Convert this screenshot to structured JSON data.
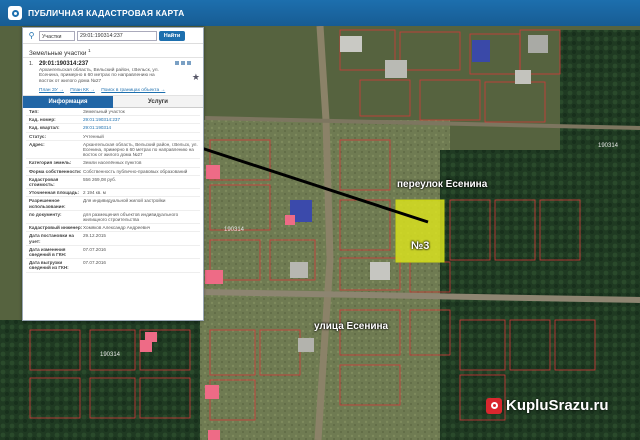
{
  "app": {
    "title": "ПУБЛИЧНАЯ КАДАСТРОВАЯ КАРТА"
  },
  "search": {
    "type": "Участки",
    "value": "29:01:190314:237",
    "button": "Найти"
  },
  "section": {
    "title": "Земельные участки",
    "count": "1"
  },
  "object": {
    "number": "1.",
    "cadastral": "29:01:190314:237",
    "address": "Архангельская область, Вельский район, г.Вельск, ул. Есенина, примерно в 60 метрах по направлению на восток от жилого дома №27",
    "links": [
      "План ЗУ →",
      "План КК →",
      "Поиск в границах объекта →"
    ]
  },
  "tabs": {
    "info": "Информация",
    "services": "Услуги"
  },
  "details": [
    {
      "k": "Тип:",
      "v": "Земельный участок"
    },
    {
      "k": "Кад. номер:",
      "v": "29:01:190314:237"
    },
    {
      "k": "Кад. квартал:",
      "v": "29:01:190314"
    },
    {
      "k": "Статус:",
      "v": "Учтенный"
    },
    {
      "k": "Адрес:",
      "v": "Архангельская область, Вельский район, г.Вельск, ул. Есенина, примерно в 60 метрах по направлению на восток от жилого дома №27"
    },
    {
      "k": "Категория земель:",
      "v": "Земли населённых пунктов"
    },
    {
      "k": "Форма собственности:",
      "v": "Собственность публично-правовых образований"
    },
    {
      "k": "Кадастровая стоимость:",
      "v": "556 269,08 руб."
    },
    {
      "k": "Уточненная площадь:",
      "v": "2 194 кв. м"
    },
    {
      "k": "Разрешенное использование:",
      "v": "Для индивидуальной жилой застройки"
    },
    {
      "k": "по документу:",
      "v": "для размещения объектов индивидуального жилищного строительства"
    },
    {
      "k": "Кадастровый инженер:",
      "v": "Хомяков Александр Андреевич"
    },
    {
      "k": "Дата постановки на учет:",
      "v": "29.12.2015"
    },
    {
      "k": "Дата изменения сведений в ГКН:",
      "v": "07.07.2016"
    },
    {
      "k": "Дата выгрузки сведений из ГКН:",
      "v": "07.07.2016"
    }
  ],
  "map": {
    "lane_label": "переулок Есенина",
    "street_label": "улица Есенина",
    "plot_label": "№3",
    "quarter_labels": [
      "190314",
      "190314",
      "190314"
    ],
    "plot_highlight_color": "#d8e020"
  },
  "watermark": {
    "text": "KupluSrazu.ru"
  }
}
